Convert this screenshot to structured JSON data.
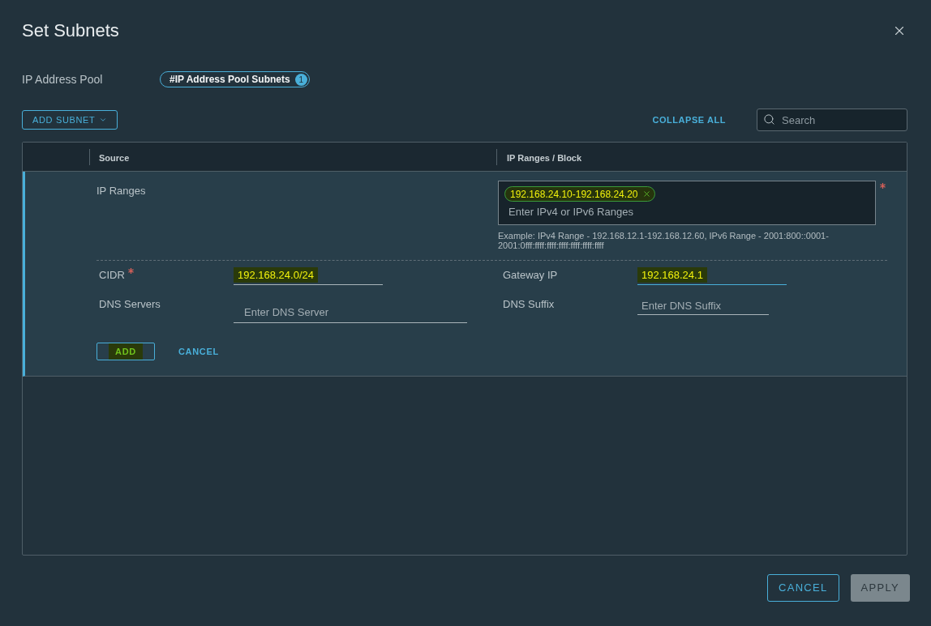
{
  "dialog": {
    "title": "Set Subnets"
  },
  "pool": {
    "label": "IP Address Pool",
    "tag": {
      "text": "#IP Address Pool Subnets",
      "count": "1"
    }
  },
  "toolbar": {
    "add_button": {
      "label": "ADD SUBNET"
    },
    "collapse_link": "COLLAPSE ALL",
    "search": {
      "placeholder": "Search"
    }
  },
  "table": {
    "columns": [
      "Source",
      "IP Ranges / Block"
    ],
    "rows": [
      {
        "ip_ranges": {
          "label": "IP Ranges",
          "required": true,
          "tags": [
            {
              "text": "192.168.24.10-192.168.24.20",
              "highlighted": true
            }
          ],
          "placeholder": "Enter IPv4 or IPv6 Ranges",
          "hint_lines": [
            "Example: IPv4 Range - 192.168.12.1-192.168.12.60, IPv6 Range - 2001:800::0001-",
            "2001:0fff:ffff:ffff:ffff:ffff:ffff:ffff"
          ]
        },
        "fields": [
          {
            "label": "CIDR",
            "required": true,
            "value": "192.168.24.0/24",
            "highlighted": true,
            "focused": false
          },
          {
            "label": "Gateway IP",
            "required": false,
            "value": "192.168.24.1",
            "highlighted": true,
            "focused": true
          },
          {
            "label": "DNS Servers",
            "required": false,
            "placeholder": "Enter DNS Server",
            "highlighted": false,
            "focused": false
          },
          {
            "label": "DNS Suffix",
            "required": false,
            "placeholder": "Enter DNS Suffix",
            "highlighted": false,
            "focused": false
          }
        ],
        "actions": [
          {
            "label": "ADD",
            "kind": "outline",
            "highlighted": true
          },
          {
            "label": "CANCEL",
            "kind": "link",
            "highlighted": false
          }
        ]
      }
    ]
  },
  "footer": {
    "buttons": [
      {
        "label": "CANCEL",
        "kind": "outline",
        "disabled": false
      },
      {
        "label": "APPLY",
        "kind": "primary",
        "disabled": true
      }
    ]
  }
}
